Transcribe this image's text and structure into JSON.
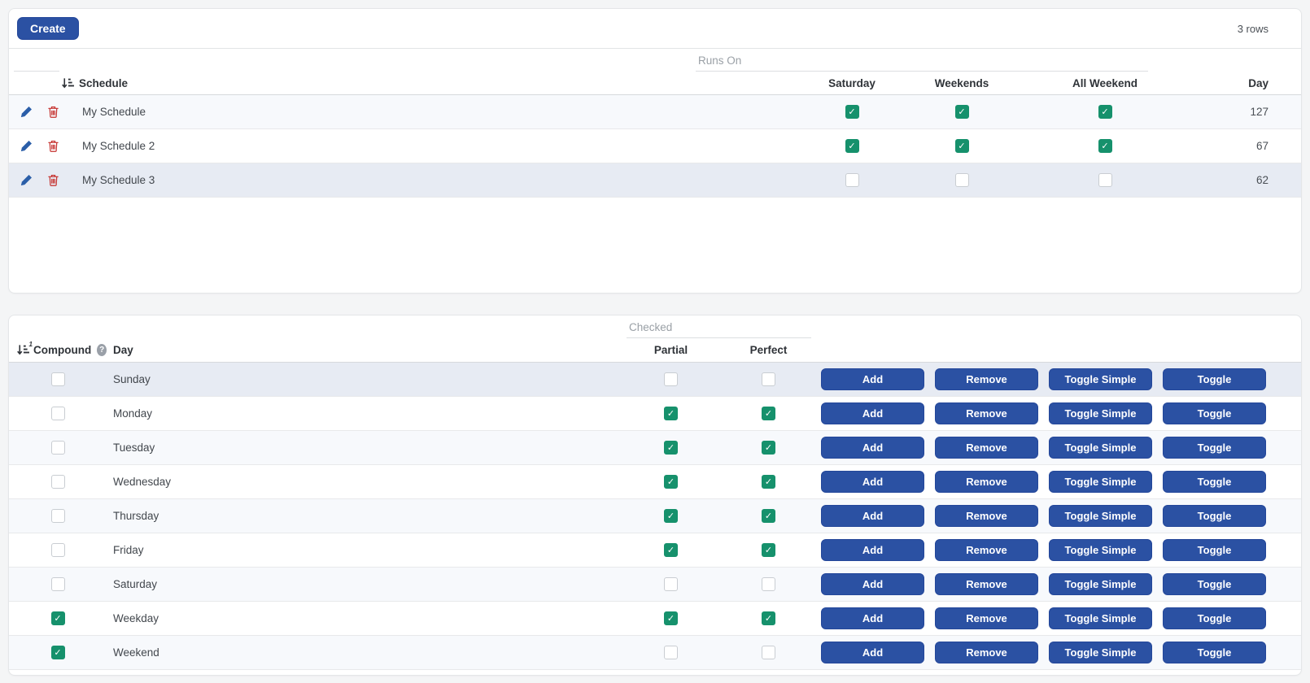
{
  "colors": {
    "accent_blue": "#2b51a3",
    "check_green": "#16916c",
    "danger_red": "#c5302d",
    "edit_blue": "#2b5ea8",
    "stripe_row": "#f7f9fc",
    "selected_row": "#e7ebf3"
  },
  "icons": {
    "sort": "sort-bars-descending",
    "edit": "pencil",
    "delete": "trash",
    "help_glyph": "?",
    "check_glyph": "✓",
    "compound_sort_badge": "1"
  },
  "schedules": {
    "toolbar": {
      "create": "Create",
      "row_count": "3 rows"
    },
    "group_header": "Runs On",
    "columns": {
      "schedule": "Schedule",
      "saturday": "Saturday",
      "weekends": "Weekends",
      "all_weekend": "All Weekend",
      "day": "Day"
    },
    "rows": [
      {
        "name": "My Schedule",
        "saturday": true,
        "weekends": true,
        "all_weekend": true,
        "day": "127",
        "selected": false
      },
      {
        "name": "My Schedule 2",
        "saturday": true,
        "weekends": true,
        "all_weekend": true,
        "day": "67",
        "selected": false
      },
      {
        "name": "My Schedule 3",
        "saturday": false,
        "weekends": false,
        "all_weekend": false,
        "day": "62",
        "selected": true
      }
    ]
  },
  "days": {
    "group_header": "Checked",
    "columns": {
      "compound": "Compound",
      "day": "Day",
      "partial": "Partial",
      "perfect": "Perfect"
    },
    "buttons": {
      "add": "Add",
      "remove": "Remove",
      "toggle_simple": "Toggle Simple",
      "toggle": "Toggle"
    },
    "rows": [
      {
        "day": "Sunday",
        "compound": false,
        "partial": false,
        "perfect": false,
        "selected": true
      },
      {
        "day": "Monday",
        "compound": false,
        "partial": true,
        "perfect": true,
        "selected": false
      },
      {
        "day": "Tuesday",
        "compound": false,
        "partial": true,
        "perfect": true,
        "selected": false
      },
      {
        "day": "Wednesday",
        "compound": false,
        "partial": true,
        "perfect": true,
        "selected": false
      },
      {
        "day": "Thursday",
        "compound": false,
        "partial": true,
        "perfect": true,
        "selected": false
      },
      {
        "day": "Friday",
        "compound": false,
        "partial": true,
        "perfect": true,
        "selected": false
      },
      {
        "day": "Saturday",
        "compound": false,
        "partial": false,
        "perfect": false,
        "selected": false
      },
      {
        "day": "Weekday",
        "compound": true,
        "partial": true,
        "perfect": true,
        "selected": false
      },
      {
        "day": "Weekend",
        "compound": true,
        "partial": false,
        "perfect": false,
        "selected": false
      }
    ]
  }
}
